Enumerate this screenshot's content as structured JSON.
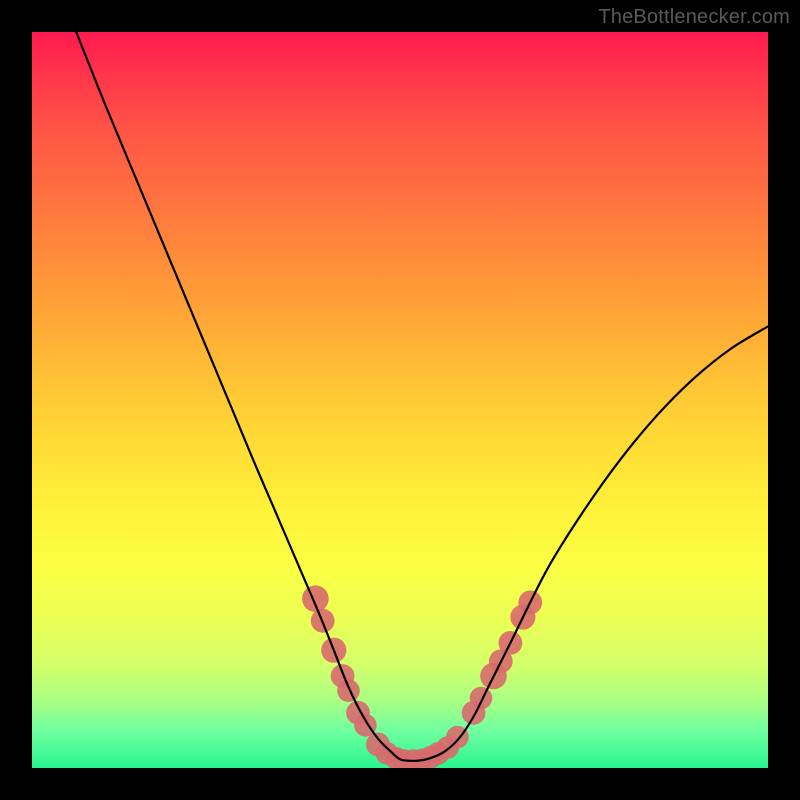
{
  "watermark": "TheBottlenecker.com",
  "colors": {
    "frame": "#000000",
    "curve": "#000000",
    "marker": "#d86a6d",
    "gradient_top": "#ff1a50",
    "gradient_bottom": "#27f58d"
  },
  "chart_data": {
    "type": "line",
    "title": "",
    "xlabel": "",
    "ylabel": "",
    "xlim": [
      0,
      100
    ],
    "ylim": [
      0,
      100
    ],
    "grid": false,
    "legend": false,
    "annotations": [],
    "series": [
      {
        "name": "bottleneck-curve",
        "x": [
          6,
          10,
          15,
          20,
          25,
          30,
          33,
          36,
          39,
          41,
          43,
          45,
          47,
          49,
          50,
          51,
          52.5,
          54,
          56,
          58,
          60,
          62,
          65,
          70,
          75,
          80,
          85,
          90,
          95,
          100
        ],
        "y": [
          100,
          90,
          78,
          66,
          54,
          42,
          35,
          28,
          21,
          16,
          11,
          7,
          4,
          2,
          1.2,
          1,
          1,
          1.3,
          2.2,
          4,
          7,
          11,
          17,
          27,
          35,
          42,
          48,
          53,
          57,
          60
        ]
      }
    ],
    "markers": {
      "name": "highlight-points",
      "points": [
        {
          "x": 38.5,
          "y": 23,
          "r": 1.4
        },
        {
          "x": 39.5,
          "y": 20,
          "r": 1.2
        },
        {
          "x": 41.0,
          "y": 16,
          "r": 1.3
        },
        {
          "x": 42.2,
          "y": 12.5,
          "r": 1.2
        },
        {
          "x": 43.0,
          "y": 10.5,
          "r": 1.1
        },
        {
          "x": 44.3,
          "y": 7.5,
          "r": 1.2
        },
        {
          "x": 45.3,
          "y": 5.8,
          "r": 1.1
        },
        {
          "x": 47.0,
          "y": 3.2,
          "r": 1.2
        },
        {
          "x": 48.2,
          "y": 2.0,
          "r": 1.1
        },
        {
          "x": 49.5,
          "y": 1.3,
          "r": 1.1
        },
        {
          "x": 50.5,
          "y": 1.0,
          "r": 1.1
        },
        {
          "x": 51.8,
          "y": 1.0,
          "r": 1.1
        },
        {
          "x": 53.0,
          "y": 1.1,
          "r": 1.1
        },
        {
          "x": 54.2,
          "y": 1.5,
          "r": 1.1
        },
        {
          "x": 55.2,
          "y": 2.0,
          "r": 1.1
        },
        {
          "x": 56.5,
          "y": 2.8,
          "r": 1.1
        },
        {
          "x": 57.8,
          "y": 4.2,
          "r": 1.1
        },
        {
          "x": 60.0,
          "y": 7.5,
          "r": 1.2
        },
        {
          "x": 61.0,
          "y": 9.5,
          "r": 1.1
        },
        {
          "x": 62.7,
          "y": 12.5,
          "r": 1.4
        },
        {
          "x": 63.7,
          "y": 14.5,
          "r": 1.2
        },
        {
          "x": 65.0,
          "y": 17.0,
          "r": 1.2
        },
        {
          "x": 66.7,
          "y": 20.5,
          "r": 1.3
        },
        {
          "x": 67.7,
          "y": 22.5,
          "r": 1.2
        }
      ]
    }
  }
}
